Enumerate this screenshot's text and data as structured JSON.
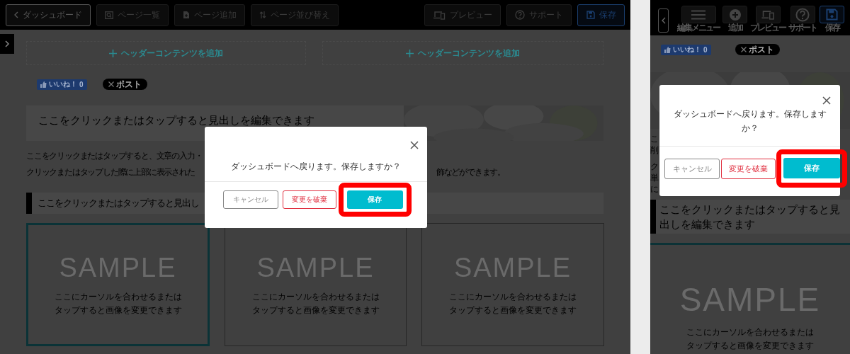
{
  "desktop": {
    "toolbar_left": [
      {
        "label": "ダッシュボード",
        "kind": "outline"
      },
      {
        "label": "ページ一覧",
        "kind": "plain"
      },
      {
        "label": "ページ追加",
        "kind": "plain"
      },
      {
        "label": "ページ並び替え",
        "kind": "plain"
      }
    ],
    "toolbar_right": [
      {
        "label": "プレビュー",
        "kind": "plain"
      },
      {
        "label": "サポート",
        "kind": "plain"
      },
      {
        "label": "保存",
        "kind": "primary"
      }
    ],
    "header_slots": [
      "ヘッダーコンテンツを追加",
      "ヘッダーコンテンツを追加"
    ],
    "like_button": {
      "label": "いいね！",
      "count": "0"
    },
    "post_button": {
      "label": "ポスト"
    },
    "heading_1": "ここをクリックまたはタップすると見出しを編集できます",
    "paragraph_lines": [
      {
        "left": "ここをクリックまたはタップすると、文章の入力・"
      },
      {
        "left": "クリックまたはタップした際に上部に表示された",
        "right": "飾などができます。"
      }
    ],
    "heading_2": "ここをクリックまたはタップすると見出し",
    "cards": [
      {
        "title": "SAMPLE",
        "caption": [
          "ここにカーソルを合わせるまたは",
          "タップすると画像を変更できます"
        ],
        "selected": true
      },
      {
        "title": "SAMPLE",
        "caption": [
          "ここにカーソルを合わせるまたは",
          "タップすると画像を変更できます"
        ],
        "selected": false
      },
      {
        "title": "SAMPLE",
        "caption": [
          "ここにカーソルを合わせるまたは",
          "タップすると画像を変更できます"
        ],
        "selected": false
      }
    ],
    "dialog": {
      "message": "ダッシュボードへ戻ります。保存しますか？",
      "buttons": [
        {
          "label": "キャンセル",
          "kind": "cancel",
          "highlighted": false
        },
        {
          "label": "変更を破棄",
          "kind": "discard",
          "highlighted": false
        },
        {
          "label": "保存",
          "kind": "save",
          "highlighted": true
        }
      ]
    }
  },
  "mobile": {
    "toolbar": [
      {
        "label": "編集メニュー",
        "kind": "plain"
      },
      {
        "label": "追加",
        "kind": "plain"
      },
      {
        "label": "プレビュー",
        "kind": "plain"
      },
      {
        "label": "サポート",
        "kind": "plain"
      },
      {
        "label": "保存",
        "kind": "primary"
      }
    ],
    "like_button": {
      "label": "いいね！",
      "count": "0"
    },
    "post_button": {
      "label": "ポスト"
    },
    "paragraphs": [
      [
        {
          "left": "こ"
        },
        {
          "left": "削"
        }
      ],
      [
        {
          "left": "ク"
        },
        {
          "left": "単"
        },
        {
          "left": "に"
        }
      ]
    ],
    "heading": "ここをクリックまたはタップすると見出しを編集できます",
    "card": {
      "title": "SAMPLE",
      "caption": [
        "ここにカーソルを合わせるまたは",
        "タップすると画像を変更できます"
      ]
    },
    "dialog": {
      "message": "ダッシュボードへ戻ります。保存しますか？",
      "buttons": [
        {
          "label": "キャンセル",
          "kind": "cancel",
          "highlighted": false
        },
        {
          "label": "変更を破棄",
          "kind": "discard",
          "highlighted": false
        },
        {
          "label": "保存",
          "kind": "save",
          "highlighted": true
        }
      ]
    }
  }
}
